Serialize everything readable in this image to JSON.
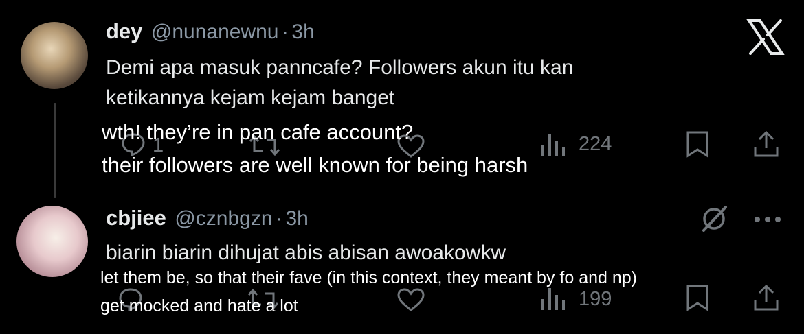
{
  "tweet1": {
    "name": "dey",
    "handle": "@nunanewnu",
    "dot": "·",
    "time": "3h",
    "text_line1": "Demi apa masuk panncafe? Followers akun itu kan",
    "text_line2": "ketikannya kejam kejam banget",
    "reply_count": "1",
    "view_count": "224"
  },
  "translation1": {
    "line1": "wth! they’re in pan cafe account?",
    "line2": "their followers are well known for being harsh"
  },
  "tweet2": {
    "name": "cbjiee",
    "handle": "@cznbgzn",
    "dot": "·",
    "time": "3h",
    "text": "biarin biarin dihujat abis abisan awoakowkw",
    "view_count": "199"
  },
  "translation2": {
    "line1": "let them be, so that their fave (in this context, they meant by fo and np)",
    "line2": "get mocked and hate a lot"
  },
  "icons": {
    "x_logo": "x-logo-icon",
    "reply": "reply-icon",
    "retweet": "retweet-icon",
    "like": "heart-icon",
    "views": "views-icon",
    "bookmark": "bookmark-icon",
    "share": "share-icon",
    "grok": "grok-icon",
    "more": "more-icon"
  },
  "colors": {
    "background": "#000000",
    "primary_text": "#e7e9ea",
    "secondary_text": "#8b98a5",
    "icon_gray": "#71767b"
  }
}
